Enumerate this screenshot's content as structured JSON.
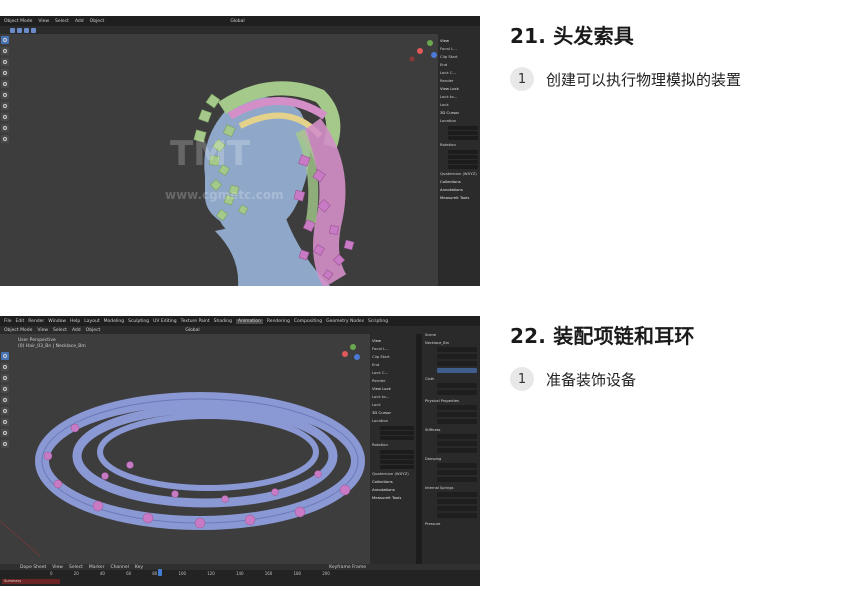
{
  "sections": [
    {
      "title": "21. 头发索具",
      "steps": [
        {
          "num": "1",
          "text": "创建可以执行物理模拟的装置"
        }
      ],
      "screenshot": {
        "header_items": [
          "Object Mode",
          "View",
          "Select",
          "Add",
          "Object",
          "Global"
        ],
        "npanel_rows": [
          "View",
          "Focal L...",
          "Clip Start",
          "End",
          "Lock C...",
          "Render",
          "View Lock",
          "Lock to...",
          "Lock",
          "To 3D",
          "Camera",
          "3D Cursor",
          "Location",
          "X",
          "Y",
          "Z",
          "Rotation",
          "W",
          "X",
          "Y",
          "Z",
          "Quaternion (WXYZ)",
          "Collections",
          "Annotations",
          "MeasureIt Tools"
        ],
        "watermark": "www.cgmetc.com"
      }
    },
    {
      "title": "22. 装配项链和耳环",
      "steps": [
        {
          "num": "1",
          "text": "准备装饰设备"
        }
      ],
      "screenshot": {
        "header_items": [
          "File",
          "Edit",
          "Render",
          "Window",
          "Help",
          "Layout",
          "Modeling",
          "Sculpting",
          "UV Editing",
          "Texture Paint",
          "Shading",
          "Animation",
          "Rendering",
          "Compositing",
          "Geometry Nodes",
          "Scripting"
        ],
        "viewport_header": [
          "Object Mode",
          "View",
          "Select",
          "Add",
          "Object",
          "Global"
        ],
        "viewport_label_1": "User Perspective",
        "viewport_label_2": "(0) Hair_03_Bn | Necklace_Bm",
        "npanel_rows": [
          "View",
          "Focal L...",
          "Clip Start",
          "End",
          "Lock C...",
          "Render",
          "View Lock",
          "Lock to...",
          "Lock",
          "Camera",
          "3D Cursor",
          "Location",
          "X",
          "Y",
          "Z",
          "Rotation",
          "W",
          "X",
          "Y",
          "Z",
          "Quaternion (WXYZ)",
          "Collections",
          "Annotations",
          "MeasureIt Tools"
        ],
        "props_sections": [
          "Scene",
          "Necklace_Bm",
          "Cloth",
          "Physical Properties",
          "Stiffness",
          "Damping",
          "Internal Springs",
          "Pressure"
        ],
        "timeline_header": [
          "Dope Sheet",
          "View",
          "Select",
          "Marker",
          "Channel",
          "Key",
          "Keyframe Frame"
        ],
        "timeline_ticks": [
          "0",
          "20",
          "40",
          "60",
          "80",
          "100",
          "120",
          "140",
          "160",
          "180",
          "200"
        ],
        "timeline_summary": "Summary"
      }
    }
  ],
  "colors": {
    "viewport_bg": "#3d3d3d",
    "header_bg": "#1f1f1f",
    "panel_bg": "#2b2b2b",
    "accent_blue": "#4772b3",
    "necklace_fill": "#8a98d4",
    "necklace_flower": "#c97ac4",
    "hair_green": "#a4c98a",
    "hair_pink": "#d48fc8",
    "skin": "#8fa8c9"
  }
}
